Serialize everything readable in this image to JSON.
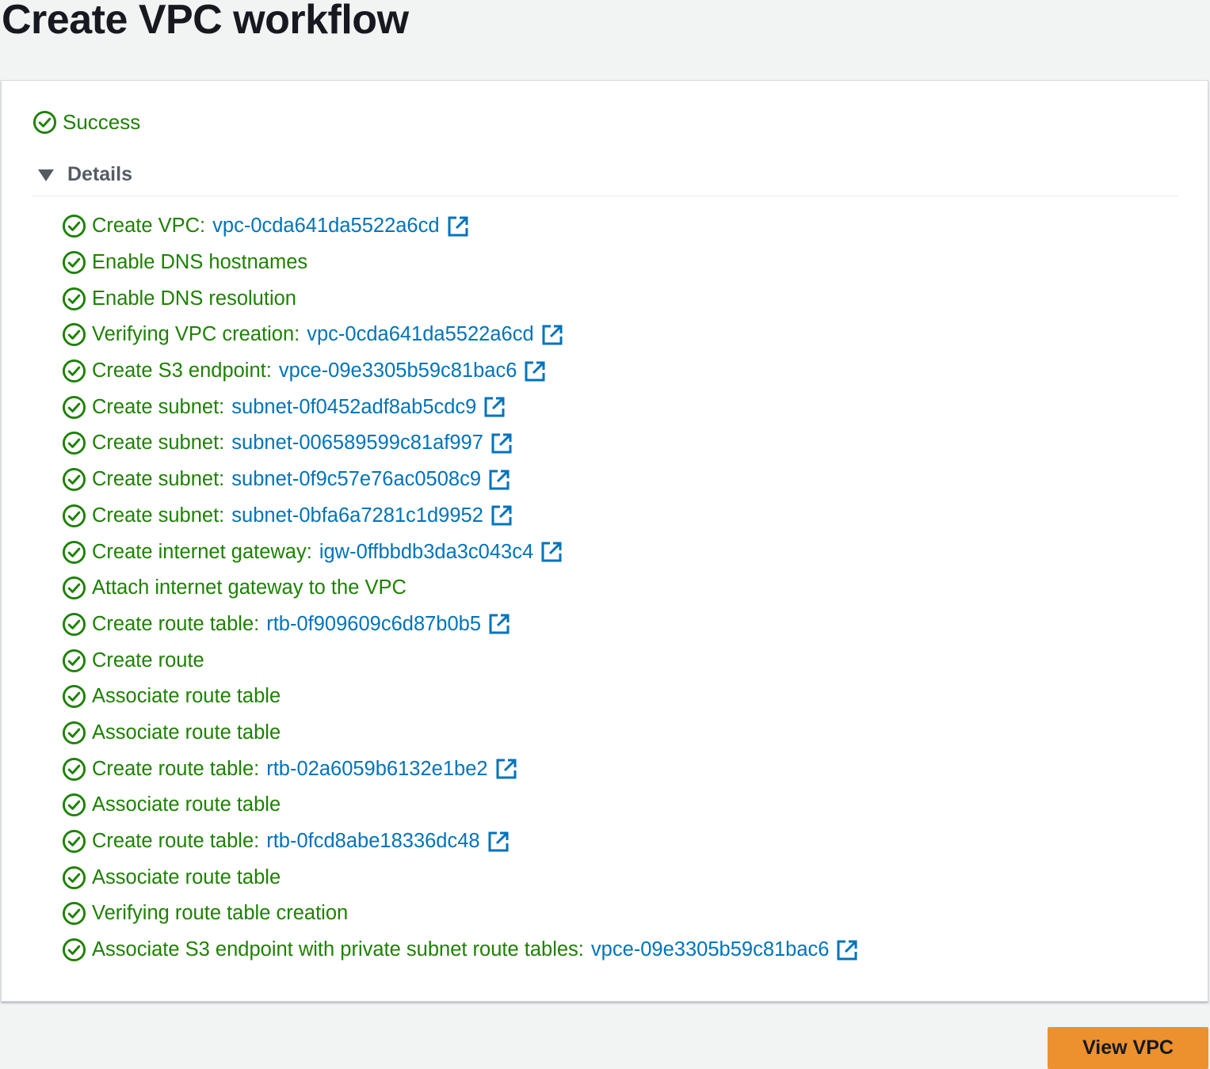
{
  "page": {
    "title": "Create VPC workflow"
  },
  "status": {
    "label": "Success",
    "icon": "check-circle-icon",
    "color": "#1d8102"
  },
  "details": {
    "label": "Details",
    "expanded": true
  },
  "steps": [
    {
      "label": "Create VPC:",
      "resource": "vpc-0cda641da5522a6cd"
    },
    {
      "label": "Enable DNS hostnames",
      "resource": null
    },
    {
      "label": "Enable DNS resolution",
      "resource": null
    },
    {
      "label": "Verifying VPC creation:",
      "resource": "vpc-0cda641da5522a6cd"
    },
    {
      "label": "Create S3 endpoint:",
      "resource": "vpce-09e3305b59c81bac6"
    },
    {
      "label": "Create subnet:",
      "resource": "subnet-0f0452adf8ab5cdc9"
    },
    {
      "label": "Create subnet:",
      "resource": "subnet-006589599c81af997"
    },
    {
      "label": "Create subnet:",
      "resource": "subnet-0f9c57e76ac0508c9"
    },
    {
      "label": "Create subnet:",
      "resource": "subnet-0bfa6a7281c1d9952"
    },
    {
      "label": "Create internet gateway:",
      "resource": "igw-0ffbbdb3da3c043c4"
    },
    {
      "label": "Attach internet gateway to the VPC",
      "resource": null
    },
    {
      "label": "Create route table:",
      "resource": "rtb-0f909609c6d87b0b5"
    },
    {
      "label": "Create route",
      "resource": null
    },
    {
      "label": "Associate route table",
      "resource": null
    },
    {
      "label": "Associate route table",
      "resource": null
    },
    {
      "label": "Create route table:",
      "resource": "rtb-02a6059b6132e1be2"
    },
    {
      "label": "Associate route table",
      "resource": null
    },
    {
      "label": "Create route table:",
      "resource": "rtb-0fcd8abe18336dc48"
    },
    {
      "label": "Associate route table",
      "resource": null
    },
    {
      "label": "Verifying route table creation",
      "resource": null
    },
    {
      "label": "Associate S3 endpoint with private subnet route tables:",
      "resource": "vpce-09e3305b59c81bac6"
    }
  ],
  "actions": {
    "view_vpc_label": "View VPC"
  },
  "colors": {
    "success": "#1d8102",
    "link": "#0073bb",
    "primary_button": "#ec912d",
    "page_background": "#f2f3f3"
  }
}
